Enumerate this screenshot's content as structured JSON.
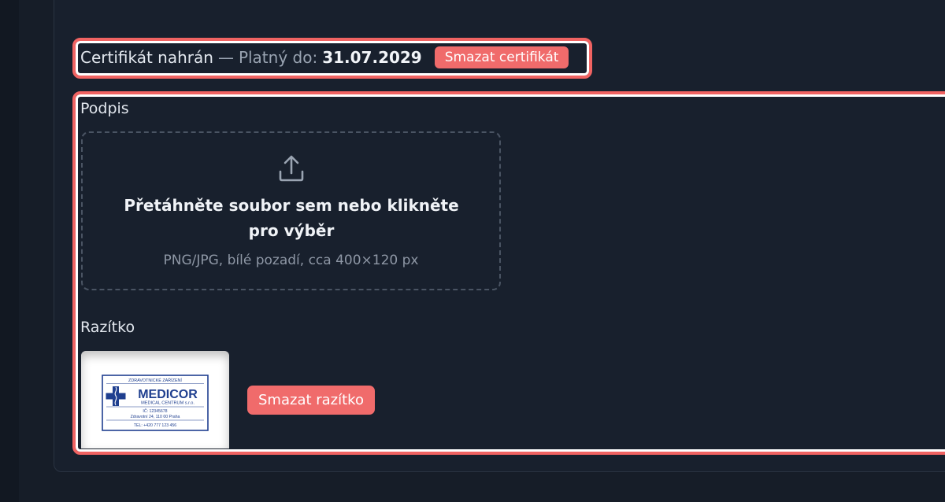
{
  "certificate": {
    "status": "Certifikát nahrán",
    "separator": "—",
    "valid_label": "Platný do:",
    "valid_date": "31.07.2029",
    "delete_label": "Smazat certifikát"
  },
  "signature": {
    "label": "Podpis",
    "drop_title": "Přetáhněte soubor sem nebo klikněte pro výběr",
    "drop_hint": "PNG/JPG, bílé pozadí, cca 400×120 px"
  },
  "stamp": {
    "label": "Razítko",
    "image": {
      "heading": "ZDRAVOTNICKÉ ZAŘÍZENÍ",
      "name": "MEDICOR",
      "subname": "MEDICAL CENTRUM s.r.o.",
      "ic": "IČ: 12345678",
      "address": "Zdravotní 24, 110 00 Praha",
      "phone": "TEL: +420 777 123 456"
    },
    "delete_label": "Smazat razítko"
  },
  "colors": {
    "background": "#161d28",
    "danger": "#f06b6b",
    "highlight": "#f06362",
    "stamp_blue": "#1f3f8f"
  }
}
